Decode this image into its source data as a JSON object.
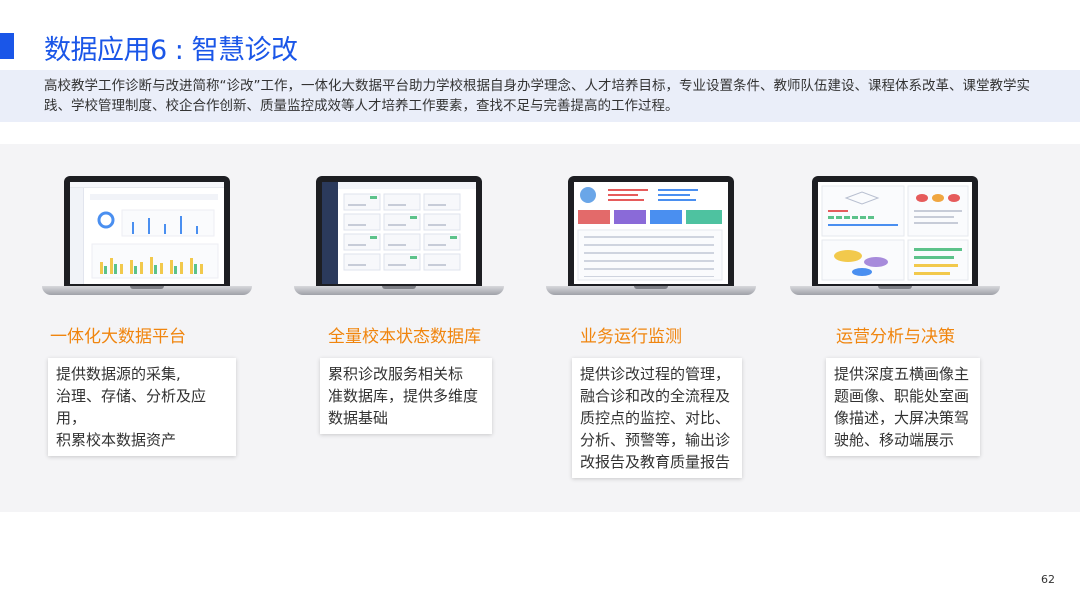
{
  "slide": {
    "title": "数据应用6 : 智慧诊改",
    "intro": "高校教学工作诊断与改进简称“诊改”工作，一体化大数据平台助力学校根据自身办学理念、人才培养目标，专业设置条件、教师队伍建设、课程体系改革、课堂教学实践、学校管理制度、校企合作创新、质量监控成效等人才培养工作要素，查找不足与完善提高的工作过程。",
    "page_number": "62"
  },
  "cards": [
    {
      "title": "一体化大数据平台",
      "text": "提供数据源的采集,\n治理、存储、分析及应用，\n积累校本数据资产"
    },
    {
      "title": "全量校本状态数据库",
      "text": "累积诊改服务相关标\n准数据库，提供多维度\n数据基础"
    },
    {
      "title": "业务运行监测",
      "text": "  提供诊改过程的管理，\n融合诊和改的全流程及\n质控点的监控、对比、\n分析、预警等，输出诊\n改报告及教育质量报告"
    },
    {
      "title": "运营分析与决策",
      "text": "提供深度五横画像主\n题画像、职能处室画\n像描述，大屏决策驾\n驶舱、移动端展示"
    }
  ],
  "colors": {
    "title_blue": "#1a56e8",
    "card_title_orange": "#f0850e",
    "intro_bg": "#eaeef9",
    "band_bg": "#f4f4f6"
  },
  "icons": [
    "laptop-dashboard-icon"
  ]
}
